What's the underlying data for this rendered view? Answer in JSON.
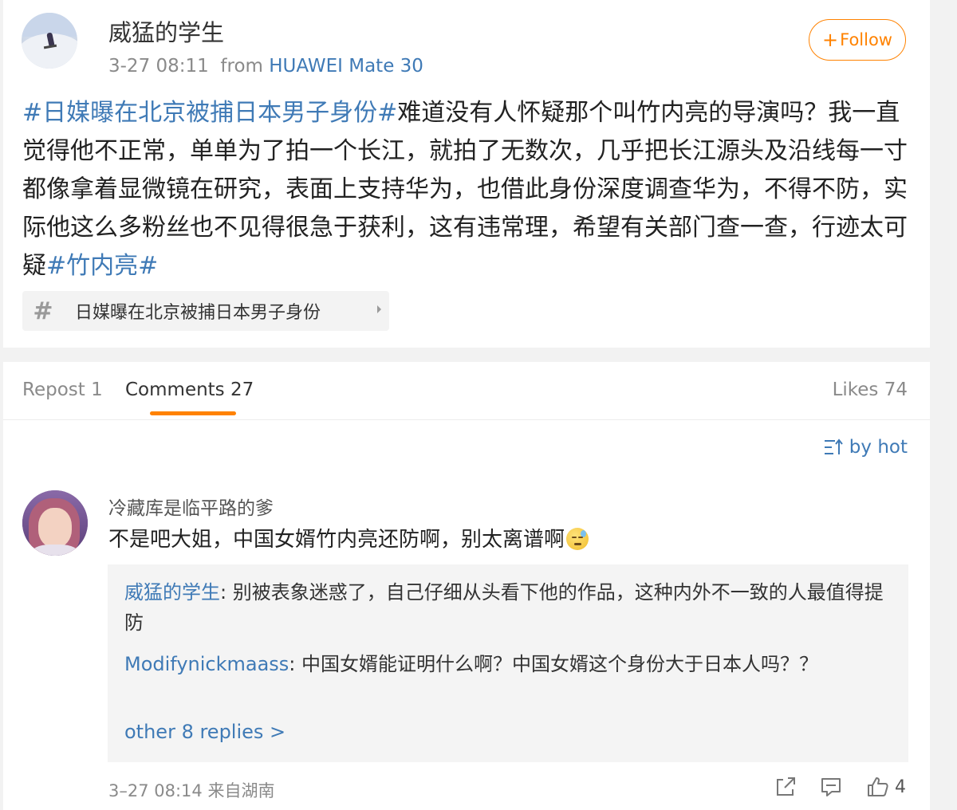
{
  "post": {
    "author": "威猛的学生",
    "time": "3-27 08:11",
    "from_label": "from",
    "source": "HUAWEI Mate 30",
    "follow_label": "Follow",
    "hashtag_open": "#日媒曝在北京被捕日本男子身份#",
    "text": "难道没有人怀疑那个叫竹内亮的导演吗？我一直觉得他不正常，单单为了拍一个长江，就拍了无数次，几乎把长江源头及沿线每一寸都像拿着显微镜在研究，表面上支持华为，也借此身份深度调查华为，不得不防，实际他这么多粉丝也不见得很急于获利，这有违常理，希望有关部门查一查，行迹太可疑",
    "hashtag_close": "#竹内亮#",
    "topic_chip": "日媒曝在北京被捕日本男子身份"
  },
  "tabs": {
    "repost": "Repost 1",
    "comments": "Comments 27",
    "likes": "Likes 74"
  },
  "sort_label": "by hot",
  "comment": {
    "author": "冷藏库是临平路的爹",
    "text": "不是吧大姐，中国女婿竹内亮还防啊，别太离谱啊",
    "emoji": "sweat-smile-emoji",
    "replies": [
      {
        "who": "威猛的学生",
        "text": ": 别被表象迷惑了，自己仔细从头看下他的作品，这种内外不一致的人最值得提防"
      },
      {
        "who": "Modifynickmaass",
        "text": ": 中国女婿能证明什么啊？中国女婿这个身份大于日本人吗？？"
      }
    ],
    "more_replies": "other 8 replies >",
    "time": "3–27 08:14",
    "location": "来自湖南",
    "like_count": "4"
  },
  "colors": {
    "accent": "#ff8200",
    "link": "#3f7ab6",
    "background": "#f2f2f2"
  }
}
